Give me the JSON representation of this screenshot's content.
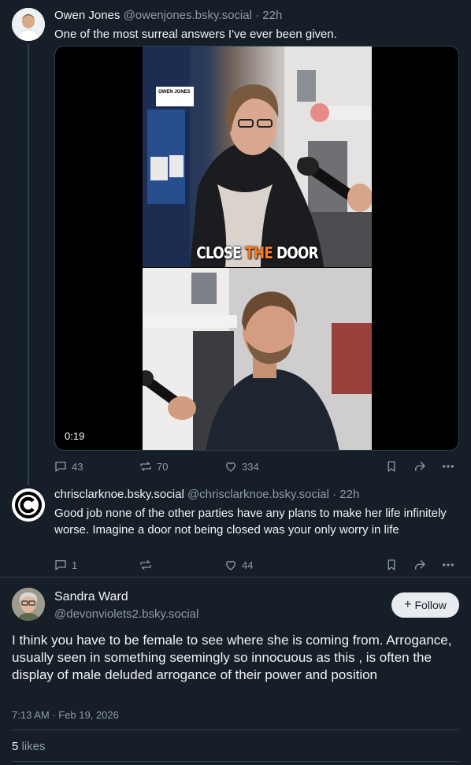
{
  "post1": {
    "display_name": "Owen Jones",
    "handle": "@owenjones.bsky.social",
    "time": "· 22h",
    "text": "One of the most surreal answers I've ever been given.",
    "video": {
      "duration": "0:19",
      "caption_part1": "CLOSE ",
      "caption_highlight": "THE",
      "caption_part2": " DOOR",
      "watermark": "OWEN JONES"
    },
    "replies": "43",
    "reposts": "70",
    "likes": "334"
  },
  "post2": {
    "display_name": "chrisclarknoe.bsky.social",
    "handle": "@chrisclarknoe.bsky.social",
    "time": "· 22h",
    "text": "Good job none of the other parties have any plans to make her life infinitely worse. Imagine a door not being closed was your only worry in life",
    "replies": "1",
    "reposts": "",
    "likes": "44"
  },
  "post3": {
    "display_name": "Sandra Ward",
    "handle": "@devonviolets2.bsky.social",
    "follow_label": "Follow",
    "text": "I think you have to be female to see where she is coming from. Arrogance, usually seen in something seemingly so innocuous as this , is often the display of male deluded arrogance of their power and position",
    "timestamp": "7:13 AM · Feb 19, 2026",
    "likes_count": "5",
    "likes_label": "likes"
  },
  "icons": {
    "reply": "reply-icon",
    "repost": "repost-icon",
    "like": "heart-icon",
    "bookmark": "bookmark-icon",
    "share": "share-icon",
    "more": "more-icon"
  },
  "colors": {
    "background": "#161e27",
    "muted": "#8e9bab",
    "text": "#f1f3f5",
    "thread_line": "#2e4052"
  }
}
